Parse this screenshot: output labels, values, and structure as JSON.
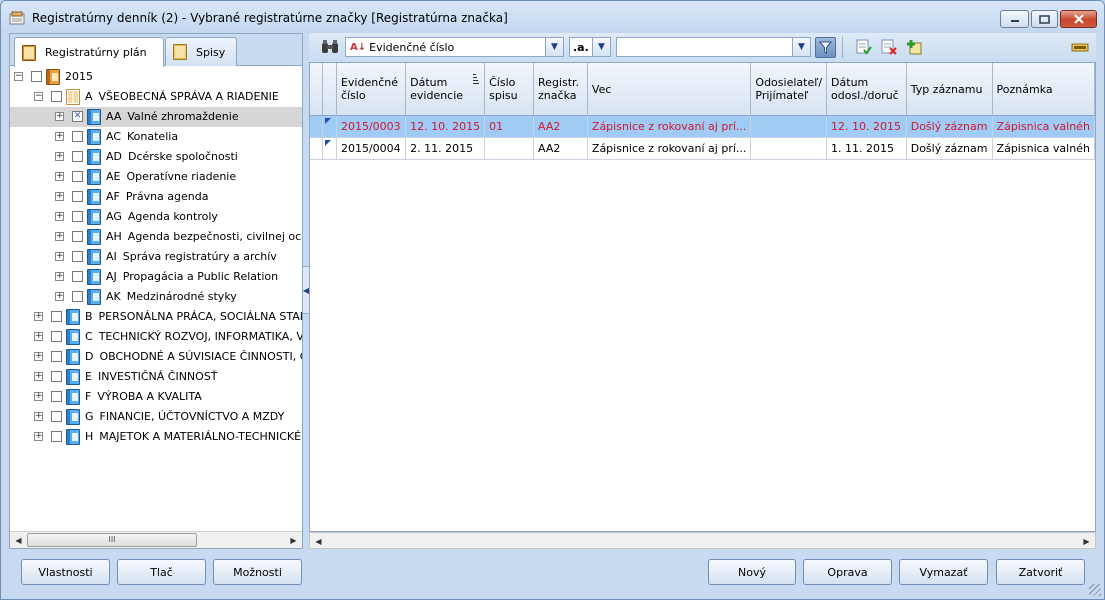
{
  "window": {
    "title": "Registratúrny denník (2) - Vybrané registratúrne značky [Registratúrna značka]"
  },
  "left_panel": {
    "tabs": [
      {
        "label": "Registratúrny plán",
        "active": true
      },
      {
        "label": "Spisy",
        "active": false
      }
    ],
    "tree": [
      {
        "code": "",
        "label": "2015",
        "level": 0,
        "expander": "minus",
        "checked": false,
        "icon": "orange-book-icon"
      },
      {
        "code": "A",
        "label": "VŠEOBECNÁ SPRÁVA A RIADENIE",
        "level": 1,
        "expander": "minus",
        "checked": false,
        "icon": "open-book-icon"
      },
      {
        "code": "AA",
        "label": "Valné zhromaždenie",
        "level": 2,
        "expander": "plus",
        "checked": true,
        "selected": true,
        "icon": "blue-book-icon"
      },
      {
        "code": "AC",
        "label": "Konatelia",
        "level": 2,
        "expander": "plus",
        "checked": false,
        "icon": "blue-book-icon"
      },
      {
        "code": "AD",
        "label": "Dcérske spoločnosti",
        "level": 2,
        "expander": "plus",
        "checked": false,
        "icon": "blue-book-icon"
      },
      {
        "code": "AE",
        "label": "Operatívne riadenie",
        "level": 2,
        "expander": "plus",
        "checked": false,
        "icon": "blue-book-icon"
      },
      {
        "code": "AF",
        "label": "Právna agenda",
        "level": 2,
        "expander": "plus",
        "checked": false,
        "icon": "blue-book-icon"
      },
      {
        "code": "AG",
        "label": "Agenda kontroly",
        "level": 2,
        "expander": "plus",
        "checked": false,
        "icon": "blue-book-icon"
      },
      {
        "code": "AH",
        "label": "Agenda bezpečnosti, civilnej ochr",
        "level": 2,
        "expander": "plus",
        "checked": false,
        "icon": "blue-book-icon"
      },
      {
        "code": "AI",
        "label": "Správa registratúry a archív",
        "level": 2,
        "expander": "plus",
        "checked": false,
        "icon": "blue-book-icon"
      },
      {
        "code": "AJ",
        "label": "Propagácia a Public Relation",
        "level": 2,
        "expander": "plus",
        "checked": false,
        "icon": "blue-book-icon"
      },
      {
        "code": "AK",
        "label": "Medzinárodné styky",
        "level": 2,
        "expander": "plus",
        "checked": false,
        "icon": "blue-book-icon"
      },
      {
        "code": "B",
        "label": "PERSONÁLNA PRÁCA, SOCIÁLNA STARO",
        "level": 1,
        "expander": "plus",
        "checked": false,
        "icon": "blue-book-icon"
      },
      {
        "code": "C",
        "label": "TECHNICKÝ ROZVOJ, INFORMATIKA, VÝS",
        "level": 1,
        "expander": "plus",
        "checked": false,
        "icon": "blue-book-icon"
      },
      {
        "code": "D",
        "label": "OBCHODNÉ A SÚVISIACE ČINNOSTI, CE",
        "level": 1,
        "expander": "plus",
        "checked": false,
        "icon": "blue-book-icon"
      },
      {
        "code": "E",
        "label": "INVESTIČNÁ ČINNOSŤ",
        "level": 1,
        "expander": "plus",
        "checked": false,
        "icon": "blue-book-icon"
      },
      {
        "code": "F",
        "label": "VÝROBA A KVALITA",
        "level": 1,
        "expander": "plus",
        "checked": false,
        "icon": "blue-book-icon"
      },
      {
        "code": "G",
        "label": "FINANCIE, ÚČTOVNÍCTVO A MZDY",
        "level": 1,
        "expander": "plus",
        "checked": false,
        "icon": "blue-book-icon"
      },
      {
        "code": "H",
        "label": "MAJETOK A MATERIÁLNO-TECHNICKÉ ZÁ",
        "level": 1,
        "expander": "plus",
        "checked": false,
        "icon": "blue-book-icon"
      }
    ],
    "scroll_thumb_label": "III"
  },
  "toolbar": {
    "search_field": "Evidenčné číslo",
    "operator": ".a.",
    "value": "",
    "icons": [
      "binoculars-icon",
      "filter-icon",
      "check-rows-icon",
      "uncheck-rows-icon",
      "add-record-icon",
      "settings-icon"
    ]
  },
  "grid": {
    "columns": [
      "",
      "Evidenčné\nčíslo",
      "Dátum\nevidencie",
      "Číslo spisu",
      "Registr.\nznačka",
      "Vec",
      "Odosielateľ/\nPrijímateľ",
      "Dátum\nodosl./doruč",
      "Typ záznamu",
      "Poznámka"
    ],
    "rows": [
      {
        "selected": true,
        "cells": [
          "",
          "2015/0003",
          "12. 10. 2015",
          "01",
          "AA2",
          "Zápisnice z rokovaní aj prí...",
          "",
          "12. 10. 2015",
          "Došlý záznam",
          "Zápisnica valnéh"
        ]
      },
      {
        "selected": false,
        "cells": [
          "",
          "2015/0004",
          "2. 11. 2015",
          "",
          "AA2",
          "Zápisnice z rokovaní aj prí...",
          "",
          "1. 11. 2015",
          "Došlý záznam",
          "Zápisnica valnéh"
        ]
      }
    ]
  },
  "buttons": {
    "vlastnosti": "Vlastnosti",
    "tlac": "Tlač",
    "moznosti": "Možnosti",
    "novy": "Nový",
    "oprava": "Oprava",
    "vymazat": "Vymazať",
    "zatvorit": "Zatvoriť"
  },
  "colors": {
    "selected_row_bg": "#9fcbf5",
    "selected_row_text": "#d2182e",
    "window_bg": "#c7daf0"
  }
}
